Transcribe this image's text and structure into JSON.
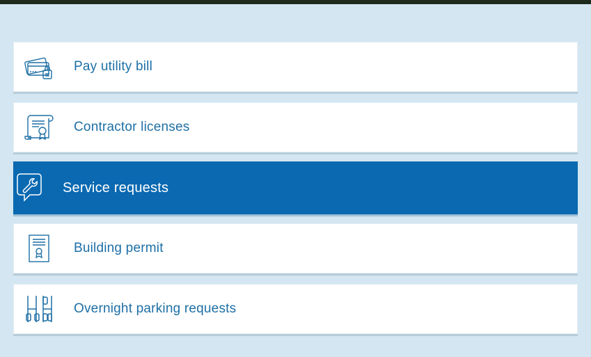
{
  "colors": {
    "background": "#d4e6f1",
    "item_bg": "#ffffff",
    "text": "#1d6fa5",
    "active_bg": "#0a69b1",
    "active_text": "#ffffff"
  },
  "menu": {
    "items": [
      {
        "label": "Pay utility bill",
        "icon": "credit-card-icon",
        "active": false
      },
      {
        "label": "Contractor licenses",
        "icon": "certificate-scroll-icon",
        "active": false
      },
      {
        "label": "Service requests",
        "icon": "wrench-chat-icon",
        "active": true
      },
      {
        "label": "Building permit",
        "icon": "permit-document-icon",
        "active": false
      },
      {
        "label": "Overnight parking requests",
        "icon": "parking-meters-icon",
        "active": false
      }
    ]
  }
}
